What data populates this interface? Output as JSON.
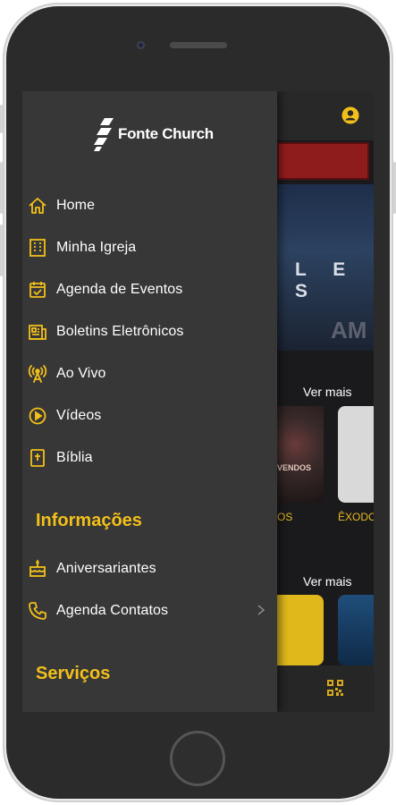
{
  "brand": {
    "name": "Fonte Church"
  },
  "background": {
    "hero_text": "L E S",
    "hero_text_2": "AM",
    "ver_mais_1": "Ver mais",
    "ver_mais_2": "Ver mais",
    "card1_overlay": "VENDOS",
    "card1_caption": "OS",
    "card2_caption": "ÊXODO"
  },
  "menu": {
    "items": [
      {
        "label": "Home",
        "icon": "home-icon"
      },
      {
        "label": "Minha Igreja",
        "icon": "building-icon"
      },
      {
        "label": "Agenda de Eventos",
        "icon": "calendar-check-icon"
      },
      {
        "label": "Boletins Eletrônicos",
        "icon": "newspaper-icon"
      },
      {
        "label": "Ao Vivo",
        "icon": "broadcast-icon"
      },
      {
        "label": "Vídeos",
        "icon": "play-circle-icon"
      },
      {
        "label": "Bíblia",
        "icon": "bible-icon"
      }
    ],
    "sections": [
      {
        "title": "Informações",
        "items": [
          {
            "label": "Aniversariantes",
            "icon": "birthday-cake-icon"
          },
          {
            "label": "Agenda Contatos",
            "icon": "phone-icon"
          }
        ]
      },
      {
        "title": "Serviços",
        "items": []
      }
    ]
  },
  "colors": {
    "accent": "#f2c01a",
    "drawer_bg": "#373737",
    "text": "#ffffff"
  }
}
